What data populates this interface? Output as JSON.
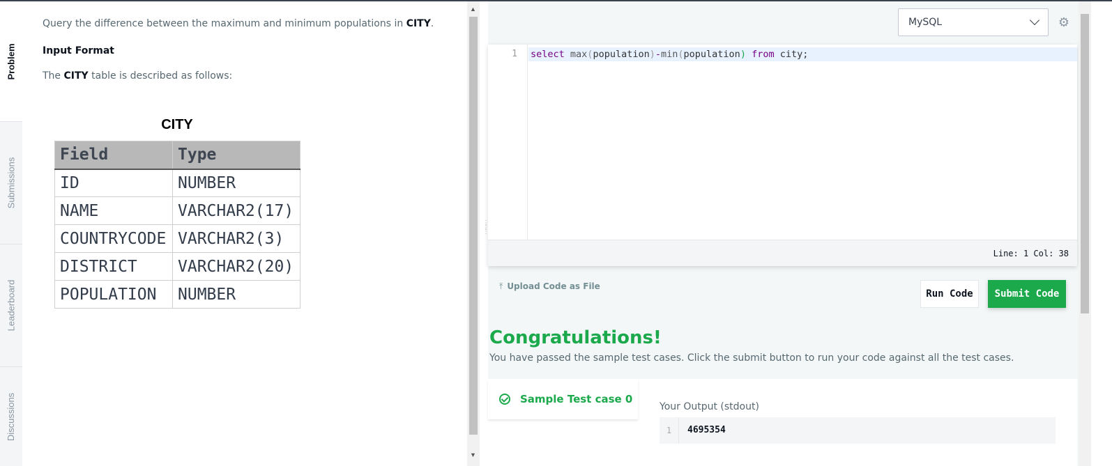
{
  "sidebar": {
    "tabs": [
      {
        "label": "Problem",
        "active": true
      },
      {
        "label": "Submissions",
        "active": false
      },
      {
        "label": "Leaderboard",
        "active": false
      },
      {
        "label": "Discussions",
        "active": false
      }
    ]
  },
  "problem": {
    "statement_pre": "Query the difference between the maximum and minimum populations in ",
    "statement_bold": "CITY",
    "statement_post": ".",
    "input_format_heading": "Input Format",
    "desc_pre": "The ",
    "desc_bold": "CITY",
    "desc_post": " table is described as follows:",
    "table_title": "CITY",
    "table_headers": [
      "Field",
      "Type"
    ],
    "table_rows": [
      [
        "ID",
        "NUMBER"
      ],
      [
        "NAME",
        "VARCHAR2(17)"
      ],
      [
        "COUNTRYCODE",
        "VARCHAR2(3)"
      ],
      [
        "DISTRICT",
        "VARCHAR2(20)"
      ],
      [
        "POPULATION",
        "NUMBER"
      ]
    ]
  },
  "editor": {
    "language": "MySQL",
    "line_number": "1",
    "code_tokens": {
      "t1": "select",
      "t2": " max",
      "t3": "(",
      "t4": "population",
      "t5": ")",
      "t6": "-",
      "t7": "min",
      "t8": "(",
      "t9": "population",
      "t10": ")",
      "t11": " from",
      "t12": " city;"
    },
    "status": "Line: 1 Col: 38"
  },
  "actions": {
    "upload_label": "Upload Code as File",
    "run_label": "Run Code",
    "submit_label": "Submit Code"
  },
  "result": {
    "heading": "Congratulations!",
    "message": "You have passed the sample test cases. Click the submit button to run your code against all the test cases.",
    "testcase_label": "Sample Test case 0",
    "output_label": "Your Output (stdout)",
    "output_line": "1",
    "output_value": "4695354"
  },
  "colors": {
    "accent_green": "#1ba94c",
    "dark_text": "#0e141e"
  }
}
